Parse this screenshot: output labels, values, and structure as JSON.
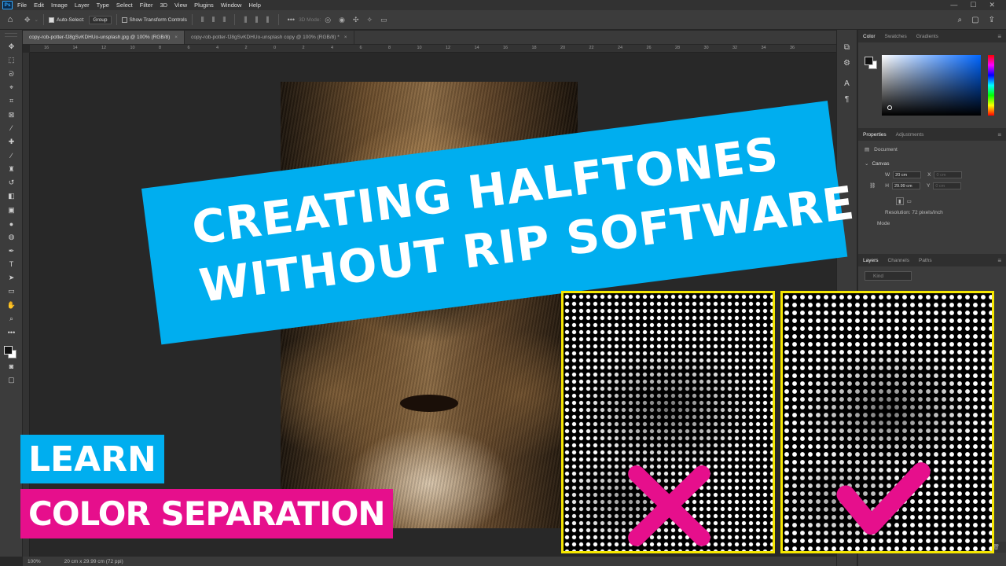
{
  "menubar": {
    "app_icon": "Ps",
    "items": [
      "File",
      "Edit",
      "Image",
      "Layer",
      "Type",
      "Select",
      "Filter",
      "3D",
      "View",
      "Plugins",
      "Window",
      "Help"
    ],
    "window_controls": [
      "—",
      "☐",
      "✕"
    ]
  },
  "options": {
    "auto_select_label": "Auto-Select:",
    "auto_select_value": "Group",
    "transform_label": "Show Transform Controls",
    "mode_3d": "3D Mode:"
  },
  "tabs": [
    {
      "label": "copy-rob-potter-fJ8gSvKDHUo-unsplash.jpg @ 100% (RGB/8)",
      "close": "×"
    },
    {
      "label": "copy-rob-potter-fJ8gSvKDHUo-unsplash copy @ 100% (RGB/8) *",
      "close": "×"
    }
  ],
  "ruler": {
    "ticks": [
      "16",
      "14",
      "12",
      "10",
      "8",
      "6",
      "4",
      "2",
      "0",
      "2",
      "4",
      "6",
      "8",
      "10",
      "12",
      "14",
      "16",
      "18",
      "20",
      "22",
      "24",
      "26",
      "28",
      "30",
      "32",
      "34",
      "36"
    ]
  },
  "status": {
    "zoom": "100%",
    "doc": "20 cm x 29.99 cm (72 ppi)"
  },
  "color_panel": {
    "tabs": [
      "Color",
      "Swatches",
      "Gradients"
    ]
  },
  "properties_panel": {
    "tabs": [
      "Properties",
      "Adjustments"
    ],
    "document_label": "Document",
    "section": "Canvas",
    "w_label": "W",
    "w_value": "20 cm",
    "h_label": "H",
    "h_value": "29.99 cm",
    "x_label": "X",
    "x_value": "0 cm",
    "y_label": "Y",
    "y_value": "0 cm",
    "resolution": "Resolution: 72 pixels/inch",
    "mode_label": "Mode"
  },
  "layers_panel": {
    "tabs": [
      "Layers",
      "Channels",
      "Paths"
    ],
    "kind_placeholder": "Kind"
  },
  "thumbnail": {
    "headline_line1": "CREATING HALFTONES",
    "headline_line2": "WITHOUT RIP SOFTWARE",
    "learn": "LEARN",
    "color_separation": "COLOR SEPARATION"
  },
  "colors": {
    "cyan": "#00AEEF",
    "magenta": "#E60F8C",
    "yellow_border": "#F5E600",
    "ps_blue": "#31A8FF"
  }
}
